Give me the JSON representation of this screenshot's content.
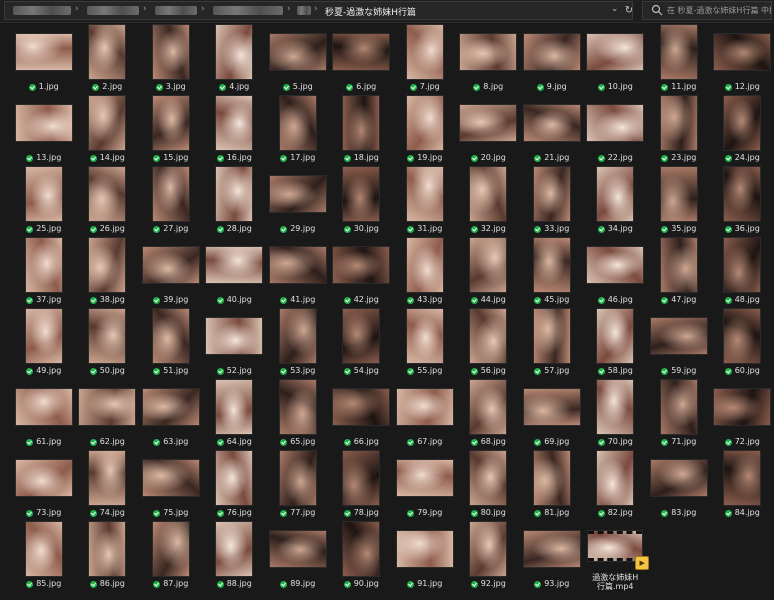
{
  "toolbar": {
    "current_folder": "秒夏-過激な姉妹H行篇",
    "search_placeholder": "在 秒夏-過激な姉妹H行篇 中搜索",
    "refresh_icon": "refresh-icon",
    "dropdown_icon": "chevron-down-icon"
  },
  "colors": {
    "sync_badge": "#21b14b",
    "background": "#191919"
  },
  "files": [
    {
      "name": "1.jpg",
      "orientation": "land"
    },
    {
      "name": "2.jpg",
      "orientation": "portrait"
    },
    {
      "name": "3.jpg",
      "orientation": "portrait"
    },
    {
      "name": "4.jpg",
      "orientation": "portrait"
    },
    {
      "name": "5.jpg",
      "orientation": "land"
    },
    {
      "name": "6.jpg",
      "orientation": "land"
    },
    {
      "name": "7.jpg",
      "orientation": "portrait"
    },
    {
      "name": "8.jpg",
      "orientation": "land"
    },
    {
      "name": "9.jpg",
      "orientation": "land"
    },
    {
      "name": "10.jpg",
      "orientation": "land"
    },
    {
      "name": "11.jpg",
      "orientation": "portrait"
    },
    {
      "name": "12.jpg",
      "orientation": "land"
    },
    {
      "name": "13.jpg",
      "orientation": "land"
    },
    {
      "name": "14.jpg",
      "orientation": "portrait"
    },
    {
      "name": "15.jpg",
      "orientation": "portrait"
    },
    {
      "name": "16.jpg",
      "orientation": "portrait"
    },
    {
      "name": "17.jpg",
      "orientation": "portrait"
    },
    {
      "name": "18.jpg",
      "orientation": "portrait"
    },
    {
      "name": "19.jpg",
      "orientation": "portrait"
    },
    {
      "name": "20.jpg",
      "orientation": "land"
    },
    {
      "name": "21.jpg",
      "orientation": "land"
    },
    {
      "name": "22.jpg",
      "orientation": "land"
    },
    {
      "name": "23.jpg",
      "orientation": "portrait"
    },
    {
      "name": "24.jpg",
      "orientation": "portrait"
    },
    {
      "name": "25.jpg",
      "orientation": "portrait"
    },
    {
      "name": "26.jpg",
      "orientation": "portrait"
    },
    {
      "name": "27.jpg",
      "orientation": "portrait"
    },
    {
      "name": "28.jpg",
      "orientation": "portrait"
    },
    {
      "name": "29.jpg",
      "orientation": "land"
    },
    {
      "name": "30.jpg",
      "orientation": "portrait"
    },
    {
      "name": "31.jpg",
      "orientation": "portrait"
    },
    {
      "name": "32.jpg",
      "orientation": "portrait"
    },
    {
      "name": "33.jpg",
      "orientation": "portrait"
    },
    {
      "name": "34.jpg",
      "orientation": "portrait"
    },
    {
      "name": "35.jpg",
      "orientation": "portrait"
    },
    {
      "name": "36.jpg",
      "orientation": "portrait"
    },
    {
      "name": "37.jpg",
      "orientation": "portrait"
    },
    {
      "name": "38.jpg",
      "orientation": "portrait"
    },
    {
      "name": "39.jpg",
      "orientation": "land"
    },
    {
      "name": "40.jpg",
      "orientation": "land"
    },
    {
      "name": "41.jpg",
      "orientation": "land"
    },
    {
      "name": "42.jpg",
      "orientation": "land"
    },
    {
      "name": "43.jpg",
      "orientation": "portrait"
    },
    {
      "name": "44.jpg",
      "orientation": "portrait"
    },
    {
      "name": "45.jpg",
      "orientation": "portrait"
    },
    {
      "name": "46.jpg",
      "orientation": "land"
    },
    {
      "name": "47.jpg",
      "orientation": "portrait"
    },
    {
      "name": "48.jpg",
      "orientation": "portrait"
    },
    {
      "name": "49.jpg",
      "orientation": "portrait"
    },
    {
      "name": "50.jpg",
      "orientation": "portrait"
    },
    {
      "name": "51.jpg",
      "orientation": "portrait"
    },
    {
      "name": "52.jpg",
      "orientation": "land"
    },
    {
      "name": "53.jpg",
      "orientation": "portrait"
    },
    {
      "name": "54.jpg",
      "orientation": "portrait"
    },
    {
      "name": "55.jpg",
      "orientation": "portrait"
    },
    {
      "name": "56.jpg",
      "orientation": "portrait"
    },
    {
      "name": "57.jpg",
      "orientation": "portrait"
    },
    {
      "name": "58.jpg",
      "orientation": "portrait"
    },
    {
      "name": "59.jpg",
      "orientation": "land"
    },
    {
      "name": "60.jpg",
      "orientation": "portrait"
    },
    {
      "name": "61.jpg",
      "orientation": "land"
    },
    {
      "name": "62.jpg",
      "orientation": "land"
    },
    {
      "name": "63.jpg",
      "orientation": "land"
    },
    {
      "name": "64.jpg",
      "orientation": "portrait"
    },
    {
      "name": "65.jpg",
      "orientation": "portrait"
    },
    {
      "name": "66.jpg",
      "orientation": "land"
    },
    {
      "name": "67.jpg",
      "orientation": "land"
    },
    {
      "name": "68.jpg",
      "orientation": "portrait"
    },
    {
      "name": "69.jpg",
      "orientation": "land"
    },
    {
      "name": "70.jpg",
      "orientation": "portrait"
    },
    {
      "name": "71.jpg",
      "orientation": "portrait"
    },
    {
      "name": "72.jpg",
      "orientation": "land"
    },
    {
      "name": "73.jpg",
      "orientation": "land"
    },
    {
      "name": "74.jpg",
      "orientation": "portrait"
    },
    {
      "name": "75.jpg",
      "orientation": "land"
    },
    {
      "name": "76.jpg",
      "orientation": "portrait"
    },
    {
      "name": "77.jpg",
      "orientation": "portrait"
    },
    {
      "name": "78.jpg",
      "orientation": "portrait"
    },
    {
      "name": "79.jpg",
      "orientation": "land"
    },
    {
      "name": "80.jpg",
      "orientation": "portrait"
    },
    {
      "name": "81.jpg",
      "orientation": "portrait"
    },
    {
      "name": "82.jpg",
      "orientation": "portrait"
    },
    {
      "name": "83.jpg",
      "orientation": "land"
    },
    {
      "name": "84.jpg",
      "orientation": "portrait"
    },
    {
      "name": "85.jpg",
      "orientation": "portrait"
    },
    {
      "name": "86.jpg",
      "orientation": "portrait"
    },
    {
      "name": "87.jpg",
      "orientation": "portrait"
    },
    {
      "name": "88.jpg",
      "orientation": "portrait"
    },
    {
      "name": "89.jpg",
      "orientation": "land"
    },
    {
      "name": "90.jpg",
      "orientation": "portrait"
    },
    {
      "name": "91.jpg",
      "orientation": "land"
    },
    {
      "name": "92.jpg",
      "orientation": "portrait"
    },
    {
      "name": "93.jpg",
      "orientation": "land"
    },
    {
      "name": "過激な姉妹H行篇.mp4",
      "orientation": "video"
    }
  ],
  "video_caption_lines": [
    "過激な姉妹H",
    "行篇.mp4"
  ]
}
